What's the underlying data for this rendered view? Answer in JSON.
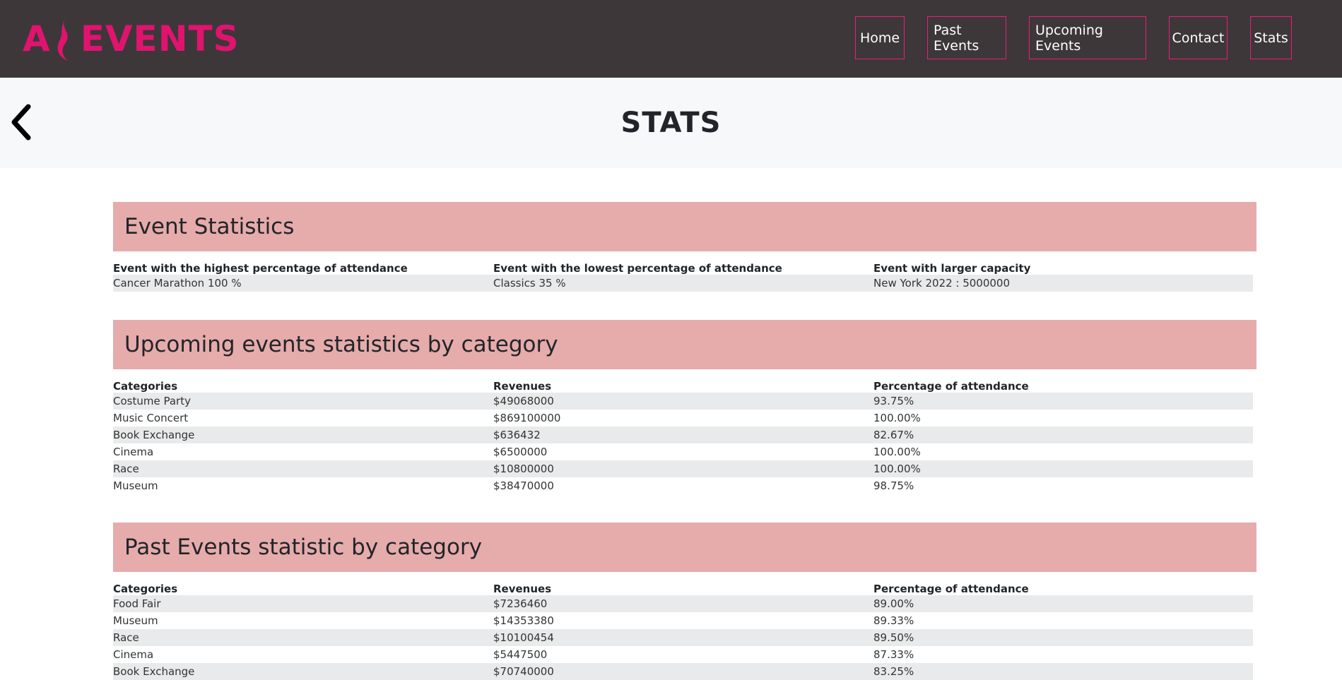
{
  "header": {
    "logo_prefix": "A",
    "logo_text": "EVENTS",
    "brand_color": "#e0136f",
    "nav": [
      {
        "label": "Home"
      },
      {
        "label": "Past Events"
      },
      {
        "label": "Upcoming Events"
      },
      {
        "label": "Contact"
      },
      {
        "label": "Stats"
      }
    ]
  },
  "hero": {
    "title": "STATS",
    "back_icon": "chevron-left-icon"
  },
  "event_statistics": {
    "title": "Event Statistics",
    "headers": [
      "Event with the highest percentage of attendance",
      "Event with the lowest percentage of attendance",
      "Event with larger capacity"
    ],
    "rows": [
      [
        "Cancer Marathon 100 %",
        "Classics 35 %",
        "New York 2022 : 5000000"
      ]
    ]
  },
  "upcoming_by_category": {
    "title": "Upcoming events statistics by category",
    "headers": [
      "Categories",
      "Revenues",
      "Percentage of attendance"
    ],
    "rows": [
      [
        "Costume Party",
        "$49068000",
        "93.75%"
      ],
      [
        "Music Concert",
        "$869100000",
        "100.00%"
      ],
      [
        "Book Exchange",
        "$636432",
        "82.67%"
      ],
      [
        "Cinema",
        "$6500000",
        "100.00%"
      ],
      [
        "Race",
        "$10800000",
        "100.00%"
      ],
      [
        "Museum",
        "$38470000",
        "98.75%"
      ]
    ]
  },
  "past_by_category": {
    "title": "Past Events statistic by category",
    "headers": [
      "Categories",
      "Revenues",
      "Percentage of attendance"
    ],
    "rows": [
      [
        "Food Fair",
        "$7236460",
        "89.00%"
      ],
      [
        "Museum",
        "$14353380",
        "89.33%"
      ],
      [
        "Race",
        "$10100454",
        "89.50%"
      ],
      [
        "Cinema",
        "$5447500",
        "87.33%"
      ],
      [
        "Book Exchange",
        "$70740000",
        "83.25%"
      ]
    ]
  }
}
